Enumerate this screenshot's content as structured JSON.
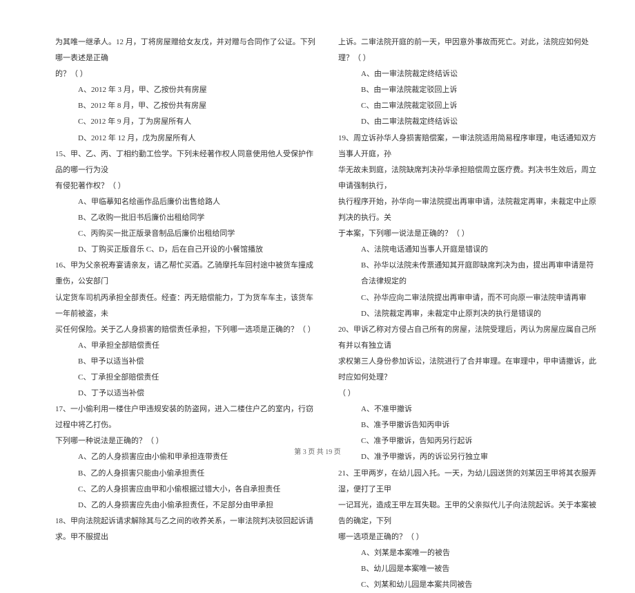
{
  "left": {
    "intro1": "为其唯一继承人。12 月，丁将房屋赠给女友戊，并对赠与合同作了公证。下列哪一表述是正确",
    "intro2": "的？（     ）",
    "q14": {
      "a": "A、2012 年 3 月，甲、乙按份共有房屋",
      "b": "B、2012 年 8 月，甲、乙按份共有房屋",
      "c": "C、2012 年 9 月，丁为房屋所有人",
      "d": "D、2012 年 12 月，戊为房屋所有人"
    },
    "q15": {
      "stem1": "15、甲、乙、丙、丁相约勤工俭学。下列未经著作权人同意使用他人受保护作品的哪一行为没",
      "stem2": "有侵犯著作权？（     ）",
      "a": "A、甲临摹知名绘画作品后廉价出售给路人",
      "b": "B、乙收购一批旧书后廉价出租给同学",
      "c": "C、丙购买一批正版录音制品后廉价出租给同学",
      "d": "D、丁购买正版音乐 C、D，后在自己开设的小餐馆播放"
    },
    "q16": {
      "stem1": "16、甲为父亲祝寿宴请亲友，请乙帮忙买酒。乙骑摩托车回村途中被货车撞成重伤，公安部门",
      "stem2": "认定货车司机丙承担全部责任。经查：丙无赔偿能力，丁为货车车主，该货车一年前被盗，未",
      "stem3": "买任何保险。关于乙人身损害的赔偿责任承担，下列哪一选项是正确的？（     ）",
      "a": "A、甲承担全部赔偿责任",
      "b": "B、甲予以适当补偿",
      "c": "C、丁承担全部赔偿责任",
      "d": "D、丁予以适当补偿"
    },
    "q17": {
      "stem1": "17、一小偷利用一楼住户甲违规安装的防盗网，进入二楼住户乙的室内，行窃过程中将乙打伤。",
      "stem2": "下列哪一种说法是正确的？（     ）",
      "a": "A、乙的人身损害应由小偷和甲承担连带责任",
      "b": "B、乙的人身损害只能由小偷承担责任",
      "c": "C、乙的人身损害应由甲和小偷根据过错大小，各自承担责任",
      "d": "D、乙的人身损害应先由小偷承担责任，不足部分由甲承担"
    },
    "q18": {
      "stem": "18、甲向法院起诉请求解除其与乙之间的收养关系，一审法院判决驳回起诉请求。甲不服提出"
    }
  },
  "right": {
    "intro1": "上诉。二审法院开庭的前一天，甲因意外事故而死亡。对此，法院应如何处理？（     ）",
    "q18": {
      "a": "A、由一审法院裁定终结诉讼",
      "b": "B、由一审法院裁定驳回上诉",
      "c": "C、由二审法院裁定驳回上诉",
      "d": "D、由二审法院裁定终结诉讼"
    },
    "q19": {
      "stem1": "19、周立诉孙华人身损害赔偿案，一审法院适用简易程序审理，电话通知双方当事人开庭，孙",
      "stem2": "华无故未到庭，法院缺席判决孙华承担赔偿周立医疗费。判决书生效后，周立申请强制执行，",
      "stem3": "执行程序开始，孙华向一审法院提出再审申请，法院裁定再审，未裁定中止原判决的执行。关",
      "stem4": "于本案，下列哪一说法是正确的？（     ）",
      "a": "A、法院电话通知当事人开庭是错误的",
      "b": "B、孙华以法院未传票通知其开庭即缺席判决为由，提出再审申请是符合法律规定的",
      "c": "C、孙华应向二审法院提出再审申请，而不可向原一审法院申请再审",
      "d": "D、法院裁定再审，未裁定中止原判决的执行是错误的"
    },
    "q20": {
      "stem1": "20、甲诉乙称对方侵占自己所有的房屋，法院受理后，丙认为房屋应属自己所有并以有独立请",
      "stem2": "求权第三人身份参加诉讼，法院进行了合并审理。在审理中，甲申请撤诉，此时应如何处理？",
      "stem3": "（     ）",
      "a": "A、不准甲撤诉",
      "b": "B、准予甲撤诉告知丙申诉",
      "c": "C、准予甲撤诉，告知丙另行起诉",
      "d": "D、准予甲撤诉，丙的诉讼另行独立审"
    },
    "q21": {
      "stem1": "21、王甲两岁，在幼儿园入托。一天，为幼儿园送货的刘某因王甲将其衣服弄湿，便打了王甲",
      "stem2": "一记耳光，造成王甲左耳失聪。王甲的父亲拟代儿子向法院起诉。关于本案被告的确定，下列",
      "stem3": "哪一选项是正确的？（     ）",
      "a": "A、刘某是本案唯一的被告",
      "b": "B、幼儿园是本案唯一被告",
      "c": "C、刘某和幼儿园是本案共同被告"
    }
  },
  "footer": "第 3 页 共 19 页"
}
